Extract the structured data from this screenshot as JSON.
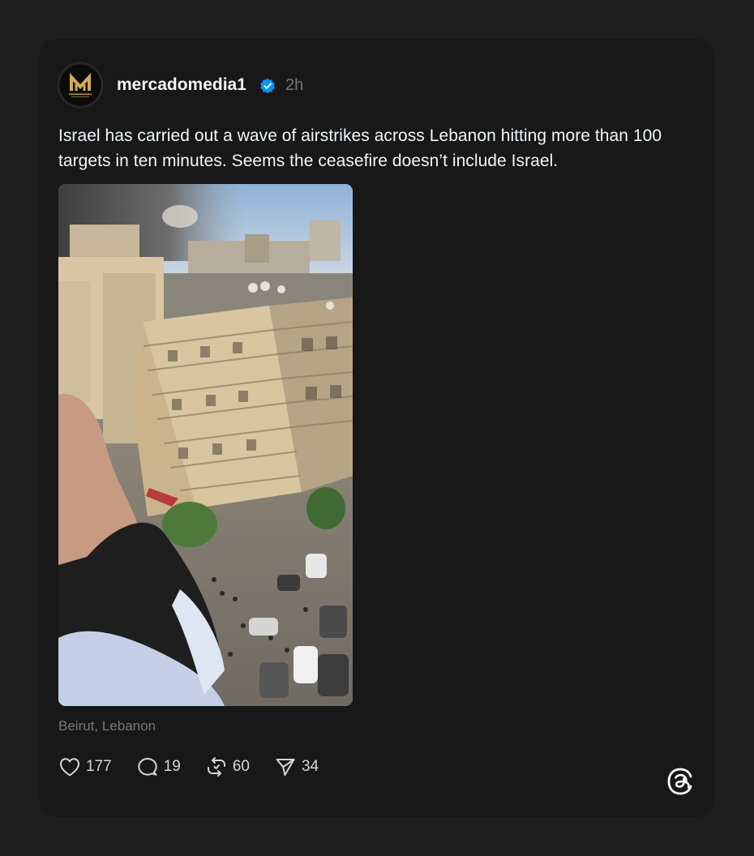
{
  "post": {
    "username": "mercadomedia1",
    "verified": true,
    "time": "2h",
    "text": "Israel has carried out a wave of airstrikes across Lebanon hitting more than 100 targets in ten minutes. Seems the ceasefire doesn’t include Israel.",
    "location": "Beirut, Lebanon",
    "avatar_logo_text": "MERCADO MEDIA"
  },
  "actions": {
    "likes": "177",
    "replies": "19",
    "reposts": "60",
    "shares": "34"
  },
  "icons": {
    "like": "heart-icon",
    "reply": "speech-bubble-icon",
    "repost": "repost-icon",
    "share": "paper-plane-icon",
    "verified": "verified-badge-icon",
    "brand": "threads-logo-icon"
  },
  "colors": {
    "page_background": "#1e1e1e",
    "card_background": "#181818",
    "primary_text": "#f3f5f7",
    "secondary_text": "#777777",
    "verified_blue": "#0095f6",
    "avatar_gold": "#c9a04a"
  }
}
